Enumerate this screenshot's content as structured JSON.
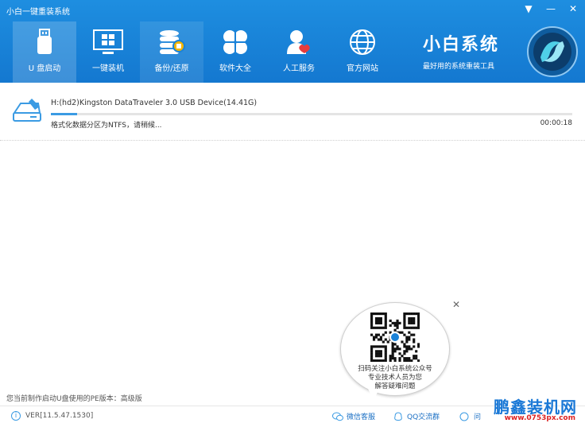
{
  "window": {
    "title": "小白一键重装系统"
  },
  "nav": {
    "items": [
      {
        "label": "U 盘启动"
      },
      {
        "label": "一键装机"
      },
      {
        "label": "备份/还原"
      },
      {
        "label": "软件大全"
      },
      {
        "label": "人工服务"
      },
      {
        "label": "官方网站"
      }
    ]
  },
  "brand": {
    "title": "小白系统",
    "subtitle": "最好用的系统重装工具"
  },
  "device": {
    "name": "H:(hd2)Kingston DataTraveler 3.0 USB Device(14.41G)",
    "status": "格式化数据分区为NTFS，请稍候...",
    "elapsed": "00:00:18",
    "progress": 0.05
  },
  "footer": {
    "pe_version": "您当前制作启动U盘使用的PE版本：高级版",
    "ver": "VER[11.5.47.1530]",
    "wechat": "微信客服",
    "qq": "QQ交流群",
    "question": "问"
  },
  "bubble": {
    "line1": "扫码关注小白系统公众号",
    "line2": "专业技术人员为您",
    "line3": "解答疑难问题"
  },
  "watermark": {
    "title": "鹏鑫装机网",
    "url": "www.0753px.com"
  },
  "colors": {
    "header": "#1a82d8",
    "accent": "#3b9be3",
    "link": "#1a6fc4"
  }
}
